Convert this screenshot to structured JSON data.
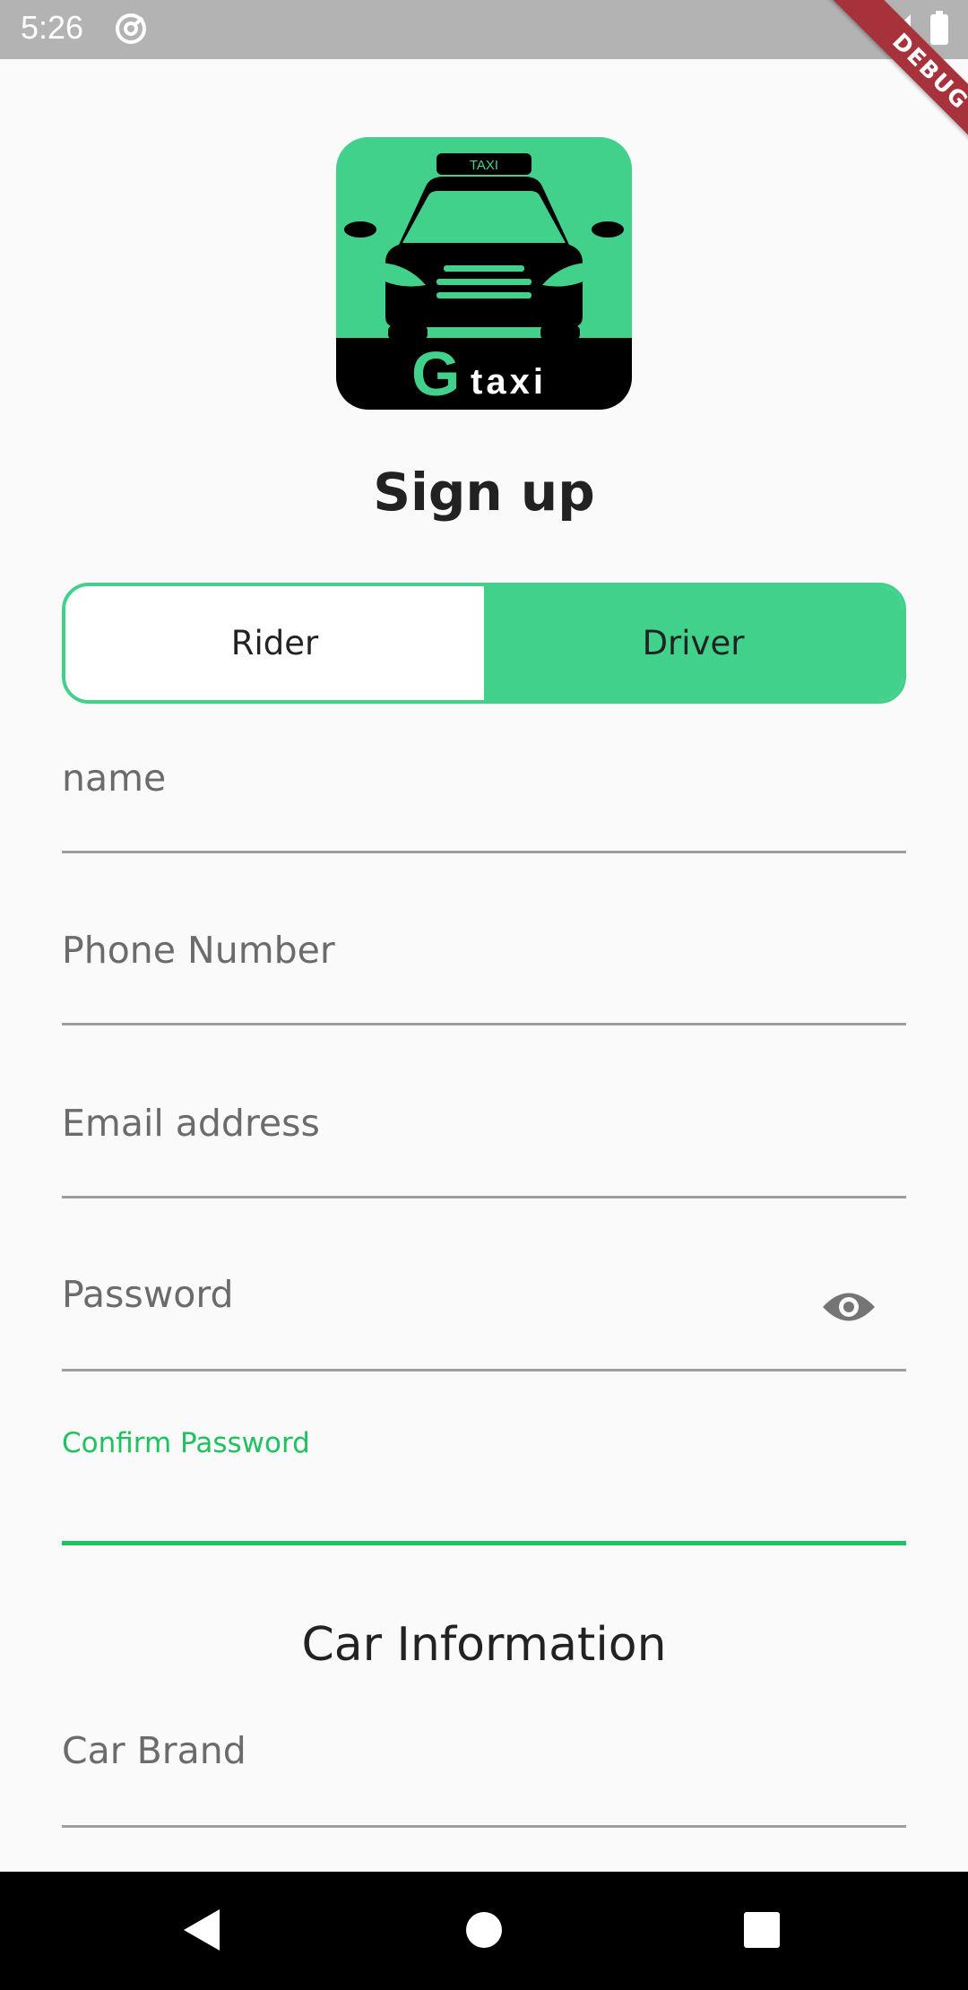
{
  "status_bar": {
    "time": "5:26",
    "debug_label": "DEBUG",
    "icons": [
      "sync-icon",
      "signal-icon",
      "battery-icon"
    ]
  },
  "logo": {
    "roof_sign": "TAXI",
    "brand_letter": "G",
    "brand_word": "taxi"
  },
  "page_title": "Sign up",
  "role_toggle": {
    "options": [
      "Rider",
      "Driver"
    ],
    "selected": "Driver"
  },
  "form": {
    "name_label": "name",
    "phone_label": "Phone Number",
    "email_label": "Email address",
    "password_label": "Password",
    "confirm_password_label": "Confirm Password"
  },
  "car_section": {
    "title": "Car Information",
    "car_brand_label": "Car Brand"
  },
  "nav_bar": {
    "icons": [
      "back-icon",
      "home-icon",
      "recents-icon"
    ]
  },
  "colors": {
    "accent_green": "#42d18b",
    "focus_green": "#1ec25f",
    "status_bar": "#b3b3b3",
    "debug_banner": "#a8323b"
  }
}
